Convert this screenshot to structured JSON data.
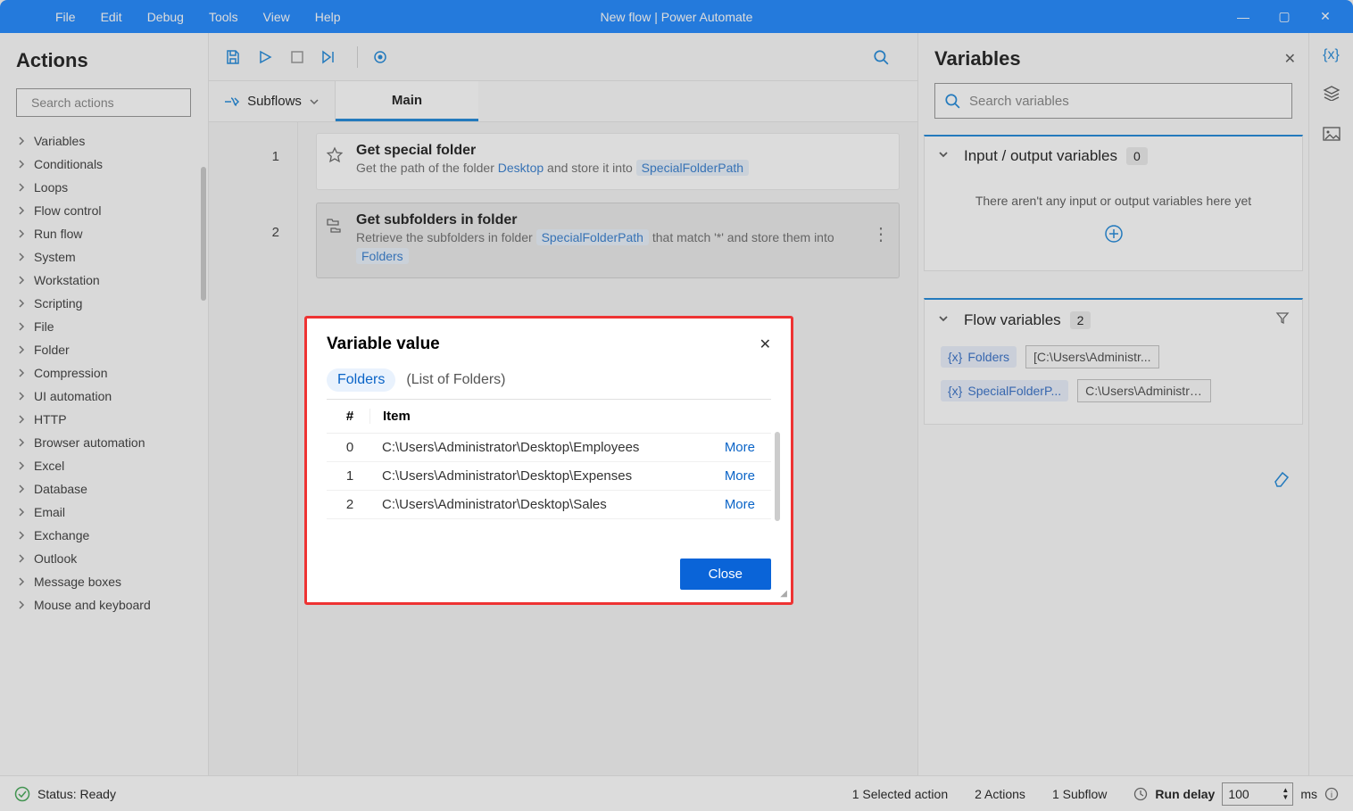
{
  "menu": [
    "File",
    "Edit",
    "Debug",
    "Tools",
    "View",
    "Help"
  ],
  "title": "New flow | Power Automate",
  "actions_panel": {
    "title": "Actions",
    "search_placeholder": "Search actions",
    "categories": [
      "Variables",
      "Conditionals",
      "Loops",
      "Flow control",
      "Run flow",
      "System",
      "Workstation",
      "Scripting",
      "File",
      "Folder",
      "Compression",
      "UI automation",
      "HTTP",
      "Browser automation",
      "Excel",
      "Database",
      "Email",
      "Exchange",
      "Outlook",
      "Message boxes",
      "Mouse and keyboard"
    ]
  },
  "tabs": {
    "subflows_label": "Subflows",
    "main_tab": "Main"
  },
  "steps": [
    {
      "num": "1",
      "title": "Get special folder",
      "desc_parts": [
        "Get the path of the folder ",
        "Desktop",
        " and store it into "
      ],
      "token": "SpecialFolderPath"
    },
    {
      "num": "2",
      "title": "Get subfolders in folder",
      "desc_pre": "Retrieve the subfolders in folder ",
      "token1": "SpecialFolderPath",
      "mid": " that match '*' and store them into ",
      "token2": "Folders"
    }
  ],
  "variables_panel": {
    "title": "Variables",
    "search_placeholder": "Search variables",
    "io": {
      "title": "Input / output variables",
      "count": "0",
      "empty": "There aren't any input or output variables here yet"
    },
    "flow": {
      "title": "Flow variables",
      "count": "2",
      "vars": [
        {
          "name": "Folders",
          "val": "[C:\\Users\\Administr..."
        },
        {
          "name": "SpecialFolderP...",
          "val": "C:\\Users\\Administra..."
        }
      ]
    }
  },
  "status": {
    "ready": "Status: Ready",
    "sel": "1 Selected action",
    "actions": "2 Actions",
    "subflows": "1 Subflow",
    "delay_label": "Run delay",
    "delay_value": "100",
    "delay_unit": "ms"
  },
  "dialog": {
    "title": "Variable value",
    "chip": "Folders",
    "type": "(List of Folders)",
    "th_num": "#",
    "th_item": "Item",
    "more": "More",
    "rows": [
      {
        "i": "0",
        "v": "C:\\Users\\Administrator\\Desktop\\Employees"
      },
      {
        "i": "1",
        "v": "C:\\Users\\Administrator\\Desktop\\Expenses"
      },
      {
        "i": "2",
        "v": "C:\\Users\\Administrator\\Desktop\\Sales"
      }
    ],
    "close": "Close"
  }
}
